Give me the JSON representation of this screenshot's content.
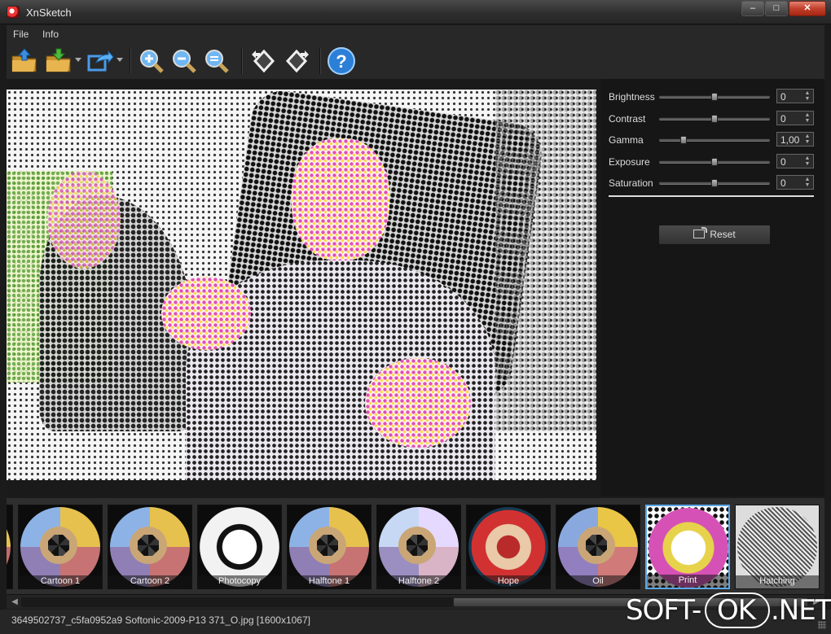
{
  "window": {
    "title": "XnSketch",
    "controls": [
      "–",
      "□",
      "✕"
    ]
  },
  "menu": {
    "file": "File",
    "info": "Info"
  },
  "toolbar": {
    "icons": [
      "open-folder-icon",
      "save-folder-icon",
      "export-icon",
      "zoom-in-icon",
      "zoom-out-icon",
      "zoom-fit-icon",
      "rotate-left-icon",
      "rotate-right-icon",
      "help-icon"
    ],
    "help_label": "?"
  },
  "adjustments": [
    {
      "label": "Brightness",
      "value": "0",
      "level": 0.5
    },
    {
      "label": "Contrast",
      "value": "0",
      "level": 0.5
    },
    {
      "label": "Gamma",
      "value": "1,00",
      "level": 0.2
    },
    {
      "label": "Exposure",
      "value": "0",
      "level": 0.5
    },
    {
      "label": "Saturation",
      "value": "0",
      "level": 0.5
    }
  ],
  "reset_label": "Reset",
  "filters": [
    {
      "label": "Cartoon 1",
      "style": "cartoon",
      "selected": false
    },
    {
      "label": "Cartoon 2",
      "style": "cartoon",
      "selected": false
    },
    {
      "label": "Photocopy",
      "style": "photocopy",
      "selected": false
    },
    {
      "label": "Halftone 1",
      "style": "cartoon",
      "selected": false
    },
    {
      "label": "Halftone 2",
      "style": "halftone2",
      "selected": false
    },
    {
      "label": "Hope",
      "style": "hope",
      "selected": false
    },
    {
      "label": "Oil",
      "style": "oil",
      "selected": false
    },
    {
      "label": "Print",
      "style": "print",
      "selected": true
    },
    {
      "label": "Hatching",
      "style": "hatching",
      "selected": false
    }
  ],
  "status": {
    "file_info": "3649502737_c5fa0952a9 Softonic-2009-P13 371_O.jpg [1600x1067]"
  },
  "watermark": {
    "left": "SOFT-",
    "middle": "OK",
    "right": ".NET"
  },
  "colors": {
    "accent": "#5aa7e6",
    "background": "#1b1b1b",
    "close": "#c2402c"
  }
}
